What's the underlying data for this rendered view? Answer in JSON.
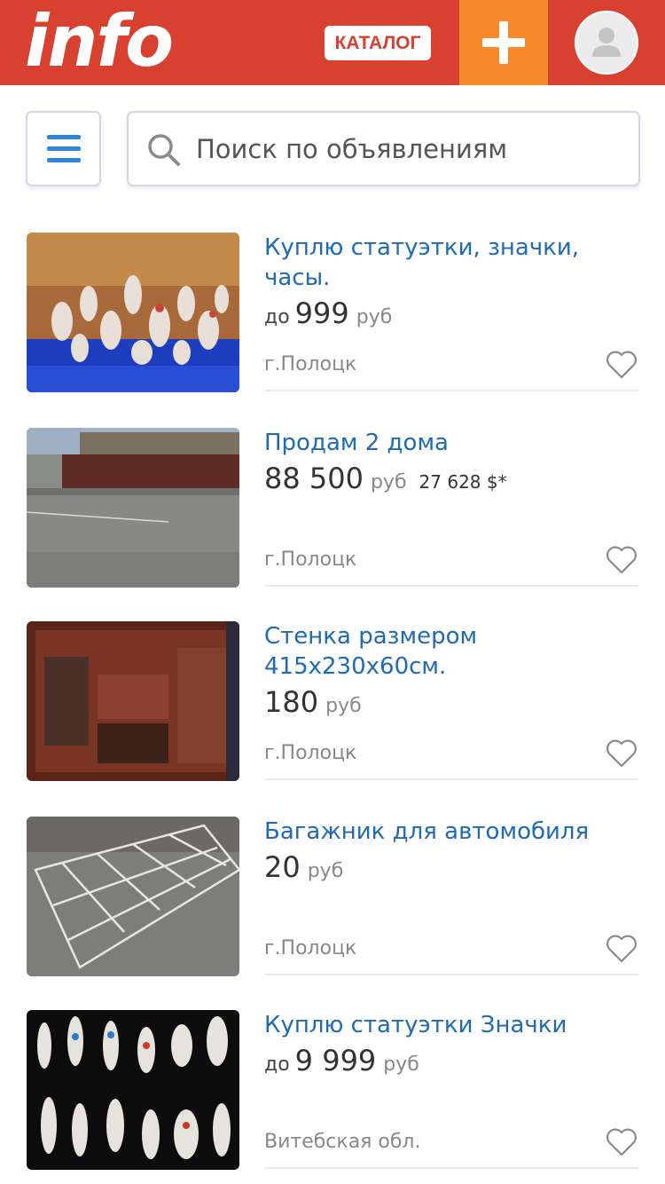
{
  "header": {
    "logo": "info",
    "catalog_label": "КАТАЛОГ",
    "colors": {
      "header_bg": "#d8412f",
      "add_bg": "#f7892b"
    }
  },
  "search": {
    "placeholder": "Поиск по объявлениям"
  },
  "listings": [
    {
      "title": "Куплю статуэтки, значки, часы.",
      "price_prefix": "до",
      "price": "999",
      "currency": "руб",
      "price_usd": "",
      "location": "г.Полоцк"
    },
    {
      "title": "Продам 2 дома",
      "price_prefix": "",
      "price": "88 500",
      "currency": "руб",
      "price_usd": "27 628 $*",
      "location": "г.Полоцк"
    },
    {
      "title": "Стенка размером 415х230х60см.",
      "price_prefix": "",
      "price": "180",
      "currency": "руб",
      "price_usd": "",
      "location": "г.Полоцк"
    },
    {
      "title": "Багажник для автомобиля",
      "price_prefix": "",
      "price": "20",
      "currency": "руб",
      "price_usd": "",
      "location": "г.Полоцк"
    },
    {
      "title": "Куплю статуэтки Значки",
      "price_prefix": "до",
      "price": "9 999",
      "currency": "руб",
      "price_usd": "",
      "location": "Витебская обл."
    }
  ],
  "icons": {
    "menu": "hamburger-icon",
    "search": "search-icon",
    "add": "plus-icon",
    "avatar": "user-avatar-icon",
    "favorite": "heart-outline-icon"
  }
}
